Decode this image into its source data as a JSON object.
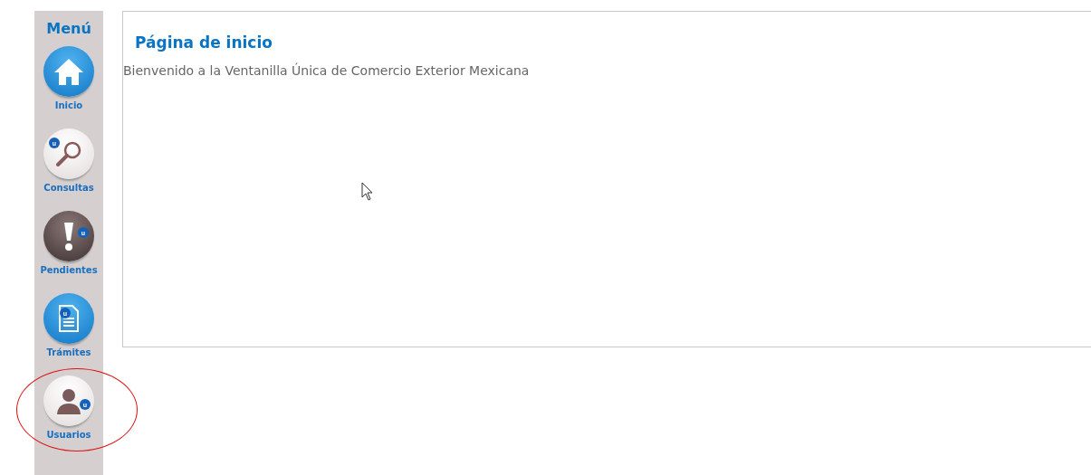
{
  "sidebar": {
    "title": "Menú",
    "items": [
      {
        "label": "Inicio",
        "kind": "home",
        "highlighted": false
      },
      {
        "label": "Consultas",
        "kind": "search",
        "badge": "u",
        "highlighted": false
      },
      {
        "label": "Pendientes",
        "kind": "alert",
        "badge": "u",
        "highlighted": false
      },
      {
        "label": "Trámites",
        "kind": "document",
        "badge": "u",
        "highlighted": false
      },
      {
        "label": "Usuarios",
        "kind": "user",
        "badge": "u",
        "highlighted": true
      }
    ]
  },
  "content": {
    "title": "Página de inicio",
    "message": "Bienvenido a la Ventanilla Única de Comercio Exterior Mexicana"
  }
}
